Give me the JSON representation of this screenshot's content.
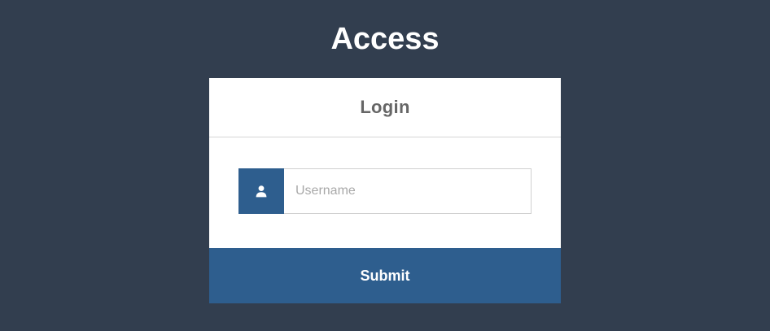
{
  "page": {
    "title": "Access"
  },
  "login_card": {
    "title": "Login",
    "username": {
      "placeholder": "Username",
      "value": "",
      "icon": "user-icon"
    },
    "submit_label": "Submit"
  },
  "colors": {
    "background": "#323e4f",
    "accent": "#2e5e8e",
    "card": "#ffffff",
    "title_text": "#666666"
  }
}
